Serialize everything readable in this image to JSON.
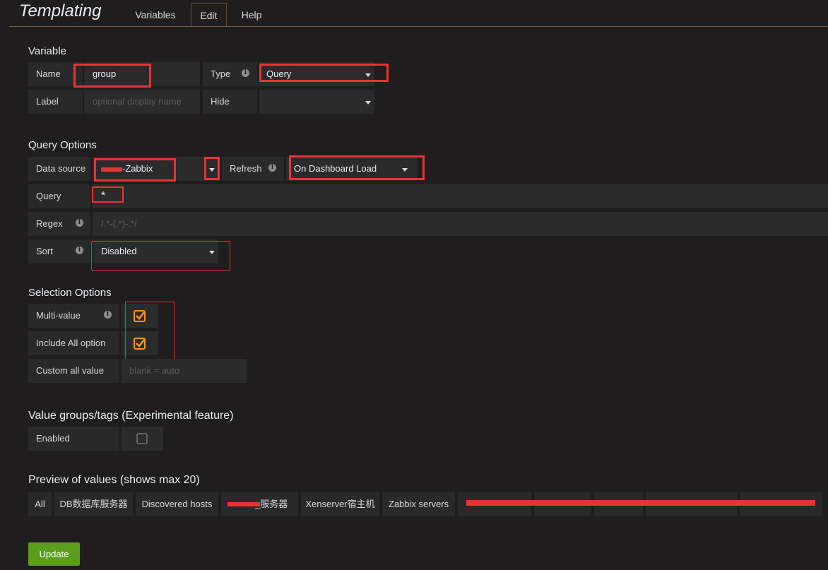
{
  "header": {
    "title": "Templating",
    "tabs": [
      {
        "label": "Variables",
        "active": false
      },
      {
        "label": "Edit",
        "active": true
      },
      {
        "label": "Help",
        "active": false
      }
    ]
  },
  "variable": {
    "section_title": "Variable",
    "name_label": "Name",
    "name_value": "group",
    "type_label": "Type",
    "type_value": "Query",
    "label_label": "Label",
    "label_placeholder": "optional display name",
    "hide_label": "Hide",
    "hide_value": ""
  },
  "query_options": {
    "section_title": "Query Options",
    "datasource_label": "Data source",
    "datasource_value": "-Zabbix",
    "refresh_label": "Refresh",
    "refresh_value": "On Dashboard Load",
    "query_label": "Query",
    "query_value": "*",
    "regex_label": "Regex",
    "regex_placeholder": "/.*-(.*)-.*/",
    "sort_label": "Sort",
    "sort_value": "Disabled"
  },
  "selection_options": {
    "section_title": "Selection Options",
    "multi_value_label": "Multi-value",
    "multi_value_checked": true,
    "include_all_label": "Include All option",
    "include_all_checked": true,
    "custom_all_label": "Custom all value",
    "custom_all_placeholder": "blank = auto"
  },
  "value_groups": {
    "section_title": "Value groups/tags (Experimental feature)",
    "enabled_label": "Enabled",
    "enabled_checked": false
  },
  "preview": {
    "section_title": "Preview of values (shows max 20)",
    "values": [
      "All",
      "DB数据库服务器",
      "Discovered hosts",
      "_服务器",
      "Xenserver宿主机",
      "Zabbix servers",
      "",
      "",
      "",
      "",
      ""
    ]
  },
  "update_button": "Update",
  "colors": {
    "background": "#1f1d1d",
    "accent_orange": "#ff9222",
    "annotation_red": "#e53434",
    "update_green": "#5b9d1d"
  }
}
